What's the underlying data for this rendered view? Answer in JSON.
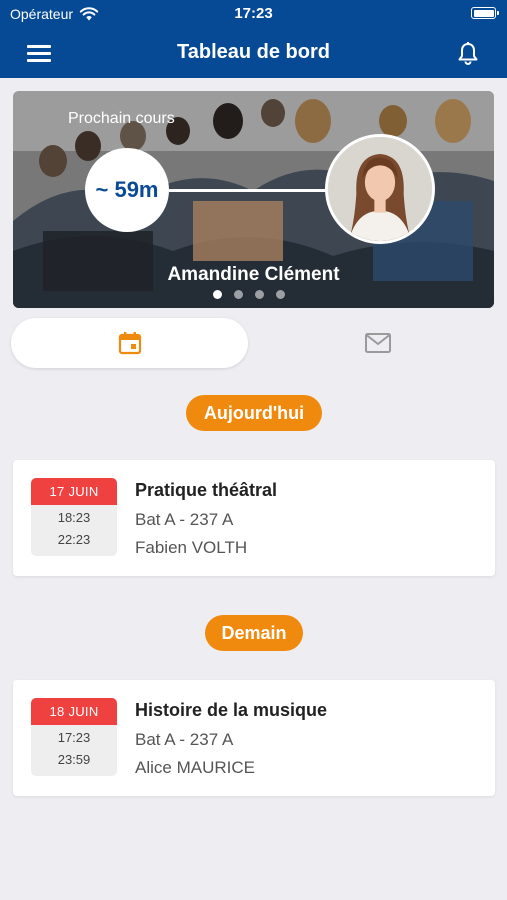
{
  "status_bar": {
    "carrier": "Opérateur",
    "time": "17:23"
  },
  "navbar": {
    "title": "Tableau de bord"
  },
  "hero": {
    "label": "Prochain cours",
    "countdown": "~ 59m",
    "teacher_name": "Amandine Clément",
    "pages": 4,
    "active_page": 1
  },
  "tabs": [
    {
      "icon": "calendar-icon",
      "selected": true,
      "color": "#f08a0f"
    },
    {
      "icon": "mail-icon",
      "selected": false,
      "color": "#9a9a9a"
    }
  ],
  "sections": [
    {
      "label": "Aujourd'hui",
      "courses": [
        {
          "day": "17 JUIN",
          "start": "18:23",
          "end": "22:23",
          "title": "Pratique théâtral",
          "room": "Bat A - 237 A",
          "teacher": "Fabien VOLTH"
        }
      ]
    },
    {
      "label": "Demain",
      "courses": [
        {
          "day": "18 JUIN",
          "start": "17:23",
          "end": "23:59",
          "title": "Histoire de la musique",
          "room": "Bat A - 237 A",
          "teacher": "Alice MAURICE"
        }
      ]
    }
  ],
  "colors": {
    "nav": "#064a96",
    "accent": "#f08a0f",
    "date_header": "#f04141",
    "countdown_text": "#0b4a95"
  }
}
